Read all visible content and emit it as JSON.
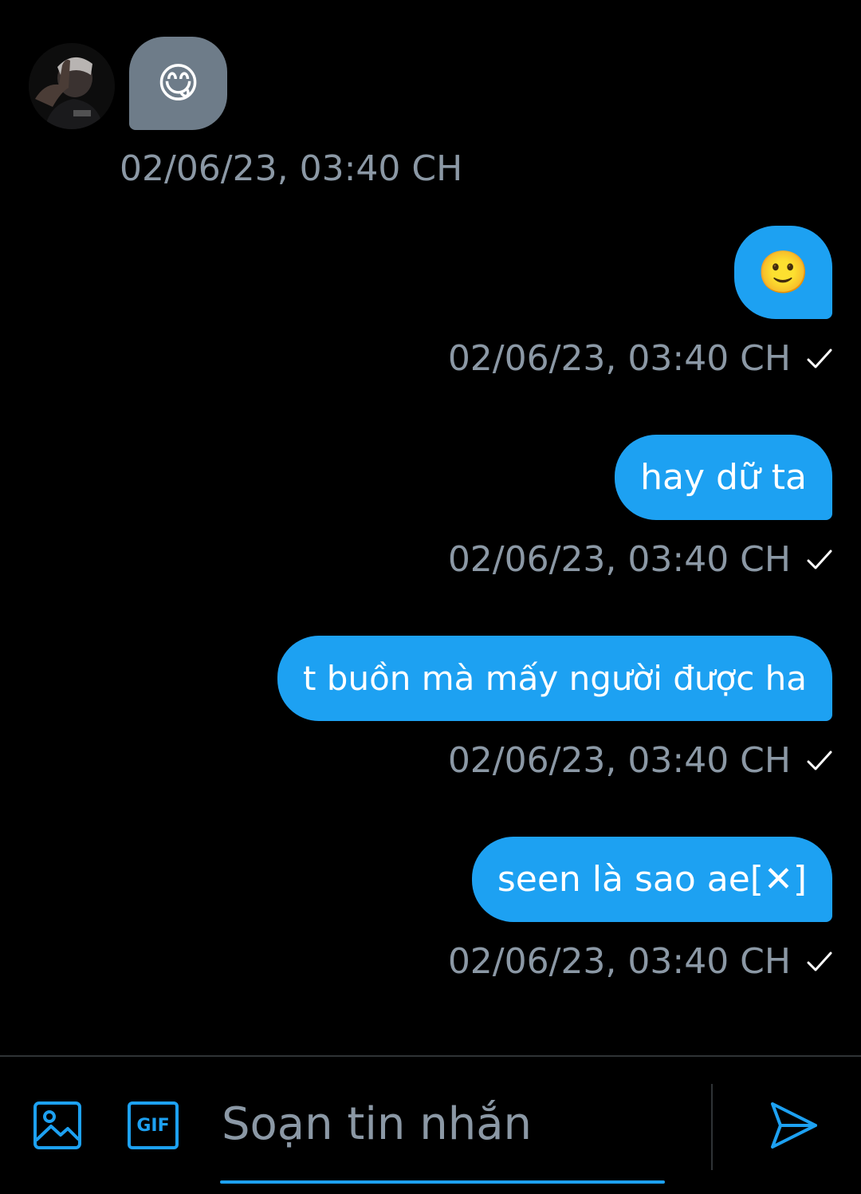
{
  "colors": {
    "background": "#000000",
    "sent_bubble": "#1da1f2",
    "received_bubble": "#6e7c89",
    "timestamp": "#8b98a5",
    "accent": "#1da1f2"
  },
  "conversation": {
    "received": [
      {
        "text": "😋",
        "timestamp": "02/06/23, 03:40 CH"
      }
    ],
    "sent": [
      {
        "text": "🙂",
        "timestamp": "02/06/23, 03:40 CH"
      },
      {
        "text": "hay dữ ta",
        "timestamp": "02/06/23, 03:40 CH"
      },
      {
        "text": "t buồn mà mấy người được ha",
        "timestamp": "02/06/23, 03:40 CH"
      },
      {
        "text": "seen là sao ae[✕]",
        "timestamp": "02/06/23, 03:40 CH"
      }
    ],
    "status_icon": "check-icon"
  },
  "composer": {
    "placeholder": "Soạn tin nhắn",
    "gif_label": "GIF",
    "icons": [
      "image-icon",
      "gif-icon",
      "send-icon"
    ]
  }
}
